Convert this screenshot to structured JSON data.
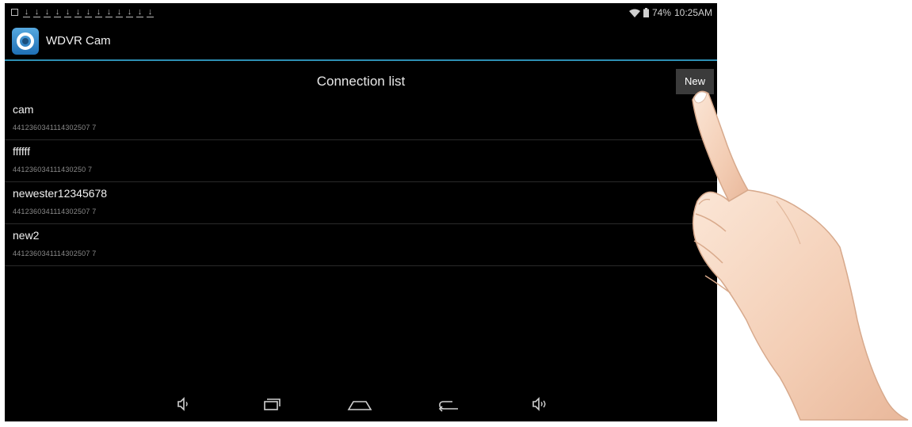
{
  "status_bar": {
    "notification_icons": [
      "gallery-icon",
      "download-icon",
      "download-icon",
      "download-icon",
      "download-icon",
      "download-icon",
      "download-icon",
      "download-icon",
      "download-icon",
      "download-icon",
      "download-icon",
      "download-icon",
      "download-icon",
      "download-icon"
    ],
    "battery": "74%",
    "time": "10:25AM"
  },
  "action_bar": {
    "app_title": "WDVR Cam"
  },
  "header": {
    "title": "Connection list",
    "new_button": "New"
  },
  "connections": [
    {
      "name": "cam",
      "id": "4412360341114302507 7"
    },
    {
      "name": "ffffff",
      "id": "441236034111430250 7"
    },
    {
      "name": "newester12345678",
      "id": "4412360341114302507 7"
    },
    {
      "name": "new2",
      "id": "4412360341114302507 7"
    }
  ],
  "nav_bar": [
    "volume-down-icon",
    "recent-apps-icon",
    "home-icon",
    "back-icon",
    "volume-up-icon"
  ],
  "colors": {
    "screen_background": "#000000",
    "accent_line": "#2d8fb3",
    "button_background": "#3b3b3b"
  }
}
